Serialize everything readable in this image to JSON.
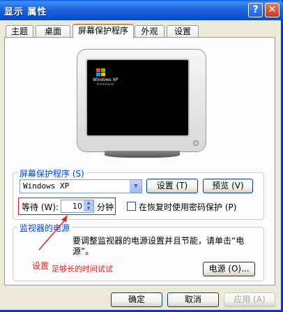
{
  "window": {
    "title": "显示 属性",
    "help_label": "?",
    "close_label": "✕"
  },
  "tabs": [
    {
      "label": "主题"
    },
    {
      "label": "桌面"
    },
    {
      "label": "屏幕保护程序",
      "active": true
    },
    {
      "label": "外观"
    },
    {
      "label": "设置"
    }
  ],
  "preview": {
    "logo_text": "Windows XP",
    "logo_sub": "Professional"
  },
  "screensaver": {
    "group_label": "屏幕保护程序 (S)",
    "selected": "Windows XP",
    "settings_button": "设置 (T)",
    "preview_button": "预览 (V)",
    "wait_label": "等待 (W):",
    "wait_value": "10",
    "wait_unit": "分钟",
    "password_label": "在恢复时使用密码保护 (P)",
    "password_checked": false
  },
  "power": {
    "group_label": "监视器的电源",
    "description_line1": "要调整监视器的电源设置并且节能，请单击“电",
    "description_line2": "源”。",
    "power_button": "电源 (O)..."
  },
  "annotation": {
    "text_part1": "设置",
    "text_part2": "足够长的时间试试",
    "color": "#e02020"
  },
  "footer": {
    "ok": "确定",
    "cancel": "取消",
    "apply": "应用 (A)"
  }
}
